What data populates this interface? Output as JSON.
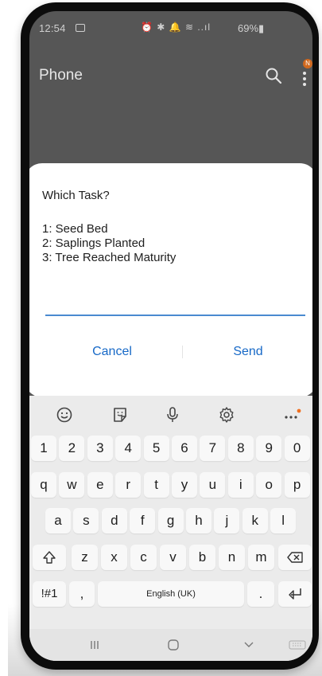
{
  "status_bar": {
    "time": "12:54",
    "indicators": "⏰ ✱ 🔔 ≋ ..ıl",
    "battery": "69%▮"
  },
  "app_bar": {
    "title": "Phone",
    "badge": "N"
  },
  "dialog": {
    "title": "Which Task?",
    "tasks": [
      "1: Seed Bed",
      "2: Saplings Planted",
      "3: Tree Reached Maturity"
    ],
    "input_value": "",
    "cancel_label": "Cancel",
    "send_label": "Send"
  },
  "keyboard": {
    "toolbar": [
      "emoji-icon",
      "sticker-icon",
      "microphone-icon",
      "settings-icon",
      "more-icon"
    ],
    "number_row": [
      "1",
      "2",
      "3",
      "4",
      "5",
      "6",
      "7",
      "8",
      "9",
      "0"
    ],
    "row1": [
      "q",
      "w",
      "e",
      "r",
      "t",
      "y",
      "u",
      "i",
      "o",
      "p"
    ],
    "row2": [
      "a",
      "s",
      "d",
      "f",
      "g",
      "h",
      "j",
      "k",
      "l"
    ],
    "row3": [
      "z",
      "x",
      "c",
      "v",
      "b",
      "n",
      "m"
    ],
    "symbols_label": "!#1",
    "comma": ",",
    "space_label": "English (UK)",
    "period": ".",
    "shift_icon": "shift-icon",
    "backspace_icon": "backspace-icon",
    "enter_icon": "enter-icon"
  },
  "nav_bar": {
    "items": [
      "recent-apps-icon",
      "home-icon",
      "back-icon",
      "keyboard-hide-icon"
    ]
  },
  "colors": {
    "accent": "#1769c7",
    "screen_dim": "#565656",
    "dialog_bg": "#ffffff",
    "keyboard_bg": "#ebebeb"
  }
}
